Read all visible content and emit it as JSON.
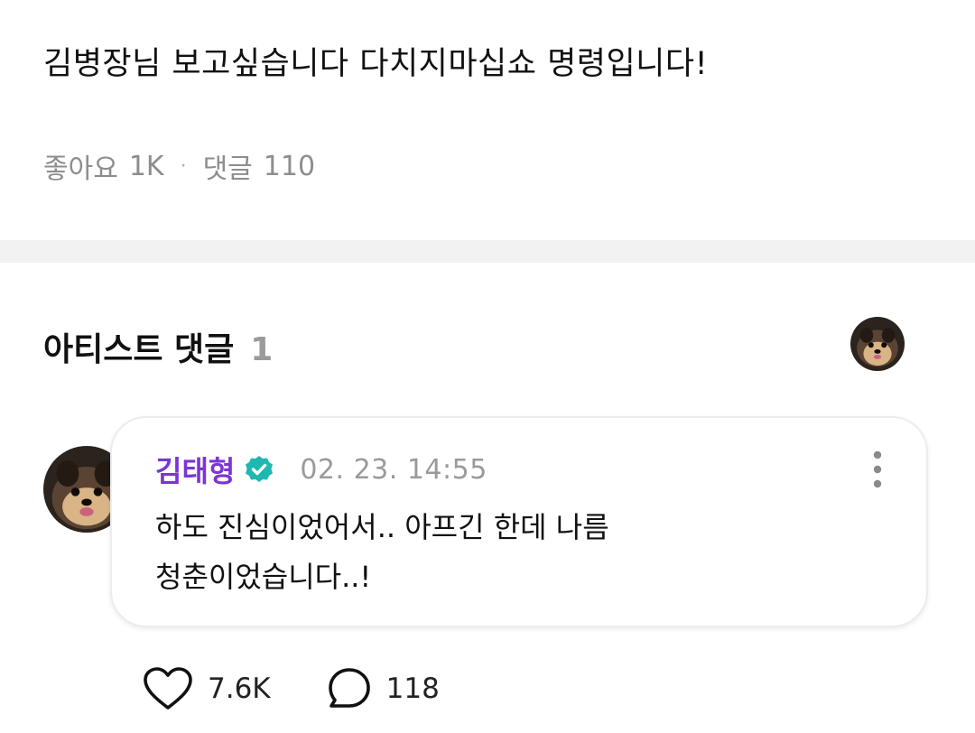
{
  "post": {
    "text": "김병장님 보고싶습니다 다치지마십쇼 명령입니다!",
    "likes_label": "좋아요",
    "likes_count": "1K",
    "separator": "·",
    "comments_label": "댓글",
    "comments_count": "110"
  },
  "artist_section": {
    "title": "아티스트 댓글",
    "count": "1",
    "avatar_icon": "dog-avatar"
  },
  "comment": {
    "author": "김태형",
    "verified_icon": "verified-badge-icon",
    "timestamp": "02. 23. 14:55",
    "body_line1": "하도 진심이었어서.. 아프긴 한데 나름",
    "body_line2": "청춘이었습니다..!",
    "more_icon": "more-vertical-icon",
    "likes": "7.6K",
    "replies": "118"
  },
  "colors": {
    "author": "#7b35d6",
    "verified": "#1fb8b0",
    "muted": "#8d8d8d",
    "divider": "#f2f2f2"
  }
}
